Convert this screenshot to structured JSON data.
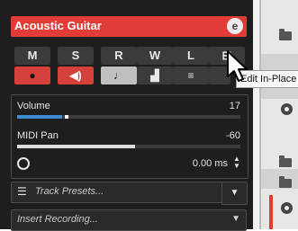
{
  "track": {
    "name": "Acoustic Guitar",
    "edit_icon": "e"
  },
  "buttons": {
    "mute": "M",
    "solo": "S",
    "read": "R",
    "write": "W",
    "lanes": "L",
    "edit_in_place": "⊟",
    "record_icon": "●",
    "monitor_icon": "◀)",
    "timebase_icon": "♩",
    "lock_icon": "▟",
    "menu_icon": "≡"
  },
  "tooltip": "Edit In-Place",
  "volume": {
    "label": "Volume",
    "value": "17",
    "level": 0.2
  },
  "midi_pan": {
    "label": "MIDI Pan",
    "value": "-60",
    "level": 0.53
  },
  "delay": {
    "value": "0.00 ms"
  },
  "presets": {
    "label": "Track Presets..."
  },
  "insert": {
    "label": "Insert Recording..."
  }
}
